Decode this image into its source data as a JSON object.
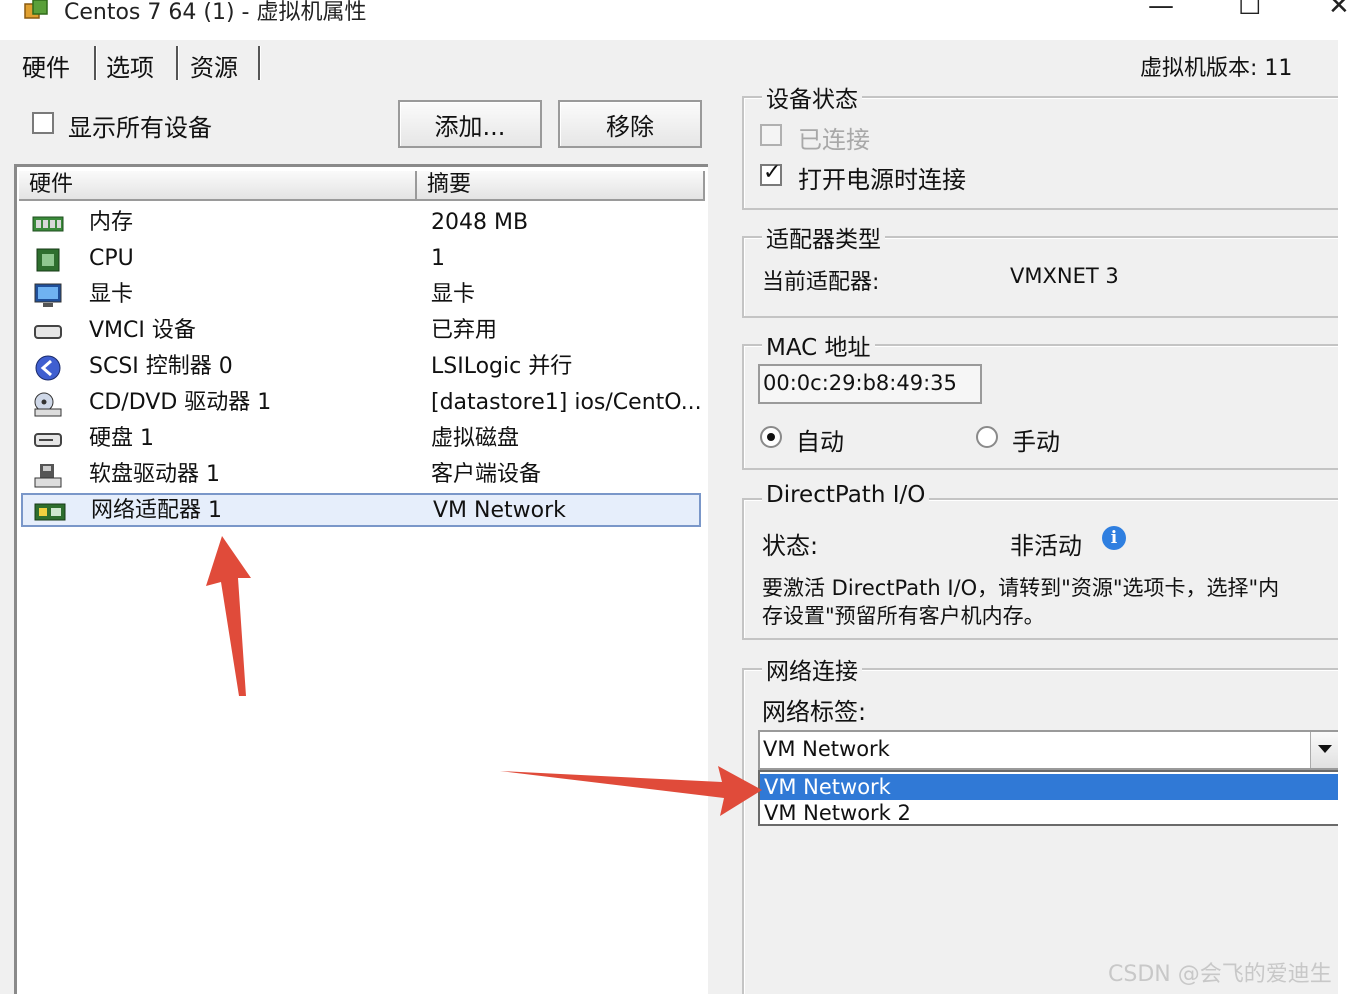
{
  "window": {
    "title": "Centos 7 64 (1) - 虚拟机属性",
    "minimize": "—",
    "maximize": "☐",
    "close": "✕"
  },
  "tabs": [
    {
      "label": "硬件"
    },
    {
      "label": "选项"
    },
    {
      "label": "资源"
    }
  ],
  "vm_version": "虚拟机版本: 11",
  "left": {
    "show_all_devices": "显示所有设备",
    "add_button": "添加...",
    "remove_button": "移除",
    "columns": {
      "hardware": "硬件",
      "summary": "摘要"
    },
    "devices": [
      {
        "icon": "memory-icon",
        "name": "内存",
        "summary": "2048 MB"
      },
      {
        "icon": "cpu-icon",
        "name": "CPU",
        "summary": "1"
      },
      {
        "icon": "display-icon",
        "name": "显卡",
        "summary": "显卡"
      },
      {
        "icon": "vmci-icon",
        "name": "VMCI 设备",
        "summary": "已弃用"
      },
      {
        "icon": "scsi-icon",
        "name": "SCSI 控制器  0",
        "summary": "LSILogic 并行"
      },
      {
        "icon": "cdrom-icon",
        "name": "CD/DVD 驱动器  1",
        "summary": "[datastore1] ios/CentO..."
      },
      {
        "icon": "disk-icon",
        "name": "硬盘  1",
        "summary": "虚拟磁盘"
      },
      {
        "icon": "floppy-icon",
        "name": "软盘驱动器  1",
        "summary": "客户端设备"
      },
      {
        "icon": "network-adapter-icon",
        "name": "网络适配器  1",
        "summary": "VM Network"
      }
    ]
  },
  "device_status": {
    "title": "设备状态",
    "connected": "已连接",
    "connect_at_power_on": "打开电源时连接"
  },
  "adapter_type": {
    "title": "适配器类型",
    "current_label": "当前适配器:",
    "current_value": "VMXNET 3"
  },
  "mac": {
    "title": "MAC 地址",
    "value": "00:0c:29:b8:49:35",
    "auto": "自动",
    "manual": "手动"
  },
  "directpath": {
    "title": "DirectPath I/O",
    "status_label": "状态:",
    "status_value": "非活动",
    "info_glyph": "i",
    "note_line1": "要激活 DirectPath I/O，请转到\"资源\"选项卡，选择\"内",
    "note_line2": "存设置\"预留所有客户机内存。"
  },
  "network": {
    "title": "网络连接",
    "label": "网络标签:",
    "selected": "VM Network",
    "options": [
      "VM Network",
      "VM Network 2"
    ]
  },
  "watermark": "CSDN @会飞的爱迪生"
}
